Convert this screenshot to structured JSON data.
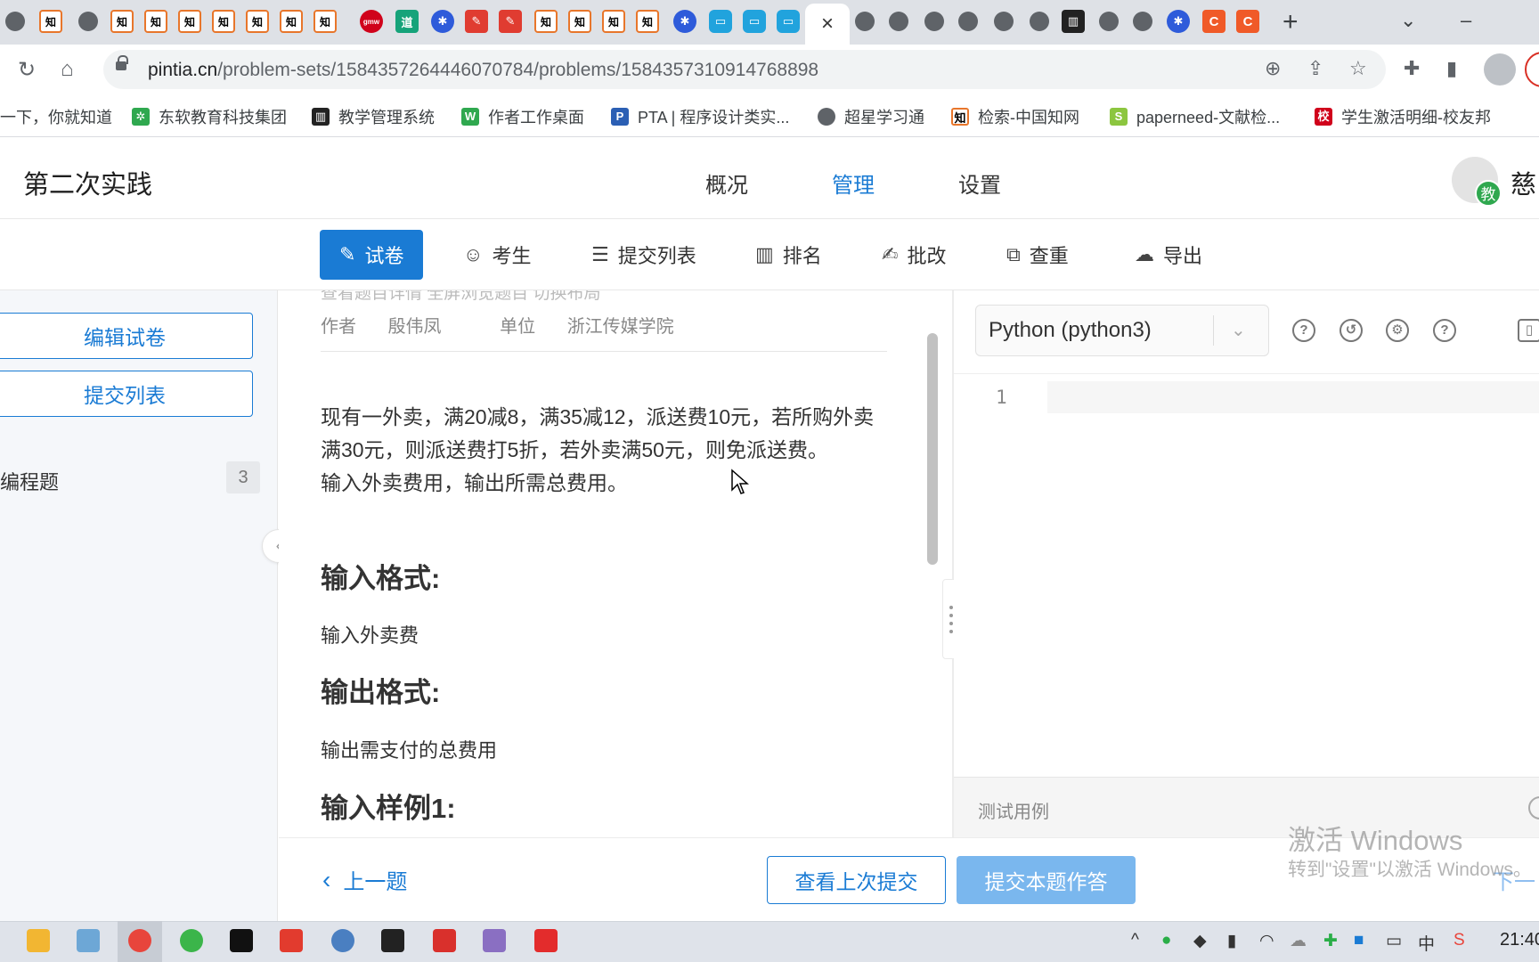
{
  "browser": {
    "active_tab_close": "×",
    "new_tab": "+",
    "url_host": "pintia.cn",
    "url_path": "/problem-sets/1584357264446070784/problems/1584357310914768898",
    "bookmarks": [
      {
        "label": "一下，你就知道",
        "icon": "baidu-icon"
      },
      {
        "label": "东软教育科技集团",
        "icon": "neusoft-icon"
      },
      {
        "label": "教学管理系统",
        "icon": "bank-icon"
      },
      {
        "label": "作者工作桌面",
        "icon": "author-icon"
      },
      {
        "label": "PTA | 程序设计类实...",
        "icon": "pta-icon"
      },
      {
        "label": "超星学习通",
        "icon": "globe-icon"
      },
      {
        "label": "检索-中国知网",
        "icon": "cnki-icon"
      },
      {
        "label": "paperneed-文献检...",
        "icon": "paperneed-icon"
      },
      {
        "label": "学生激活明细-校友邦",
        "icon": "school-icon"
      }
    ]
  },
  "app": {
    "title": "第二次实践",
    "nav": [
      "概况",
      "管理",
      "设置"
    ],
    "nav_active": "管理",
    "user_badge": "教",
    "user_name": "慈"
  },
  "subnav": {
    "tabs": [
      "试卷",
      "考生",
      "提交列表",
      "排名",
      "批改",
      "查重",
      "导出"
    ],
    "active": "试卷"
  },
  "sidebar": {
    "edit_button": "编辑试卷",
    "submissions_button": "提交列表",
    "section_label": "编程题",
    "section_count": "3",
    "collapse_icon": "‹"
  },
  "problem": {
    "meta_cut": "查看题目详情    全屏浏览题目    切换布局",
    "author_label": "作者",
    "author": "殷伟凤",
    "org_label": "单位",
    "org": "浙江传媒学院",
    "description": "现有一外卖，满20减8，满35减12，派送费10元，若所购外卖满30元，则派送费打5折，若外卖满50元，则免派送费。",
    "description2": "输入外卖费用，输出所需总费用。",
    "input_heading": "输入格式:",
    "input_text": "输入外卖费",
    "output_heading": "输出格式:",
    "output_text": "输出需支付的总费用",
    "sample_heading": "输入样例1:"
  },
  "editor": {
    "language": "Python (python3)",
    "line_number": "1",
    "test_cases_label": "测试用例"
  },
  "actions": {
    "prev": "上一题",
    "view_last": "查看上次提交",
    "submit": "提交本题作答",
    "next": "下一"
  },
  "watermark": {
    "line1": "激活 Windows",
    "line2": "转到\"设置\"以激活 Windows。"
  },
  "taskbar": {
    "ime": "中",
    "clock": "21:40"
  },
  "colors": {
    "accent": "#1a7bd4",
    "submit_disabled": "#7ab7ee"
  }
}
